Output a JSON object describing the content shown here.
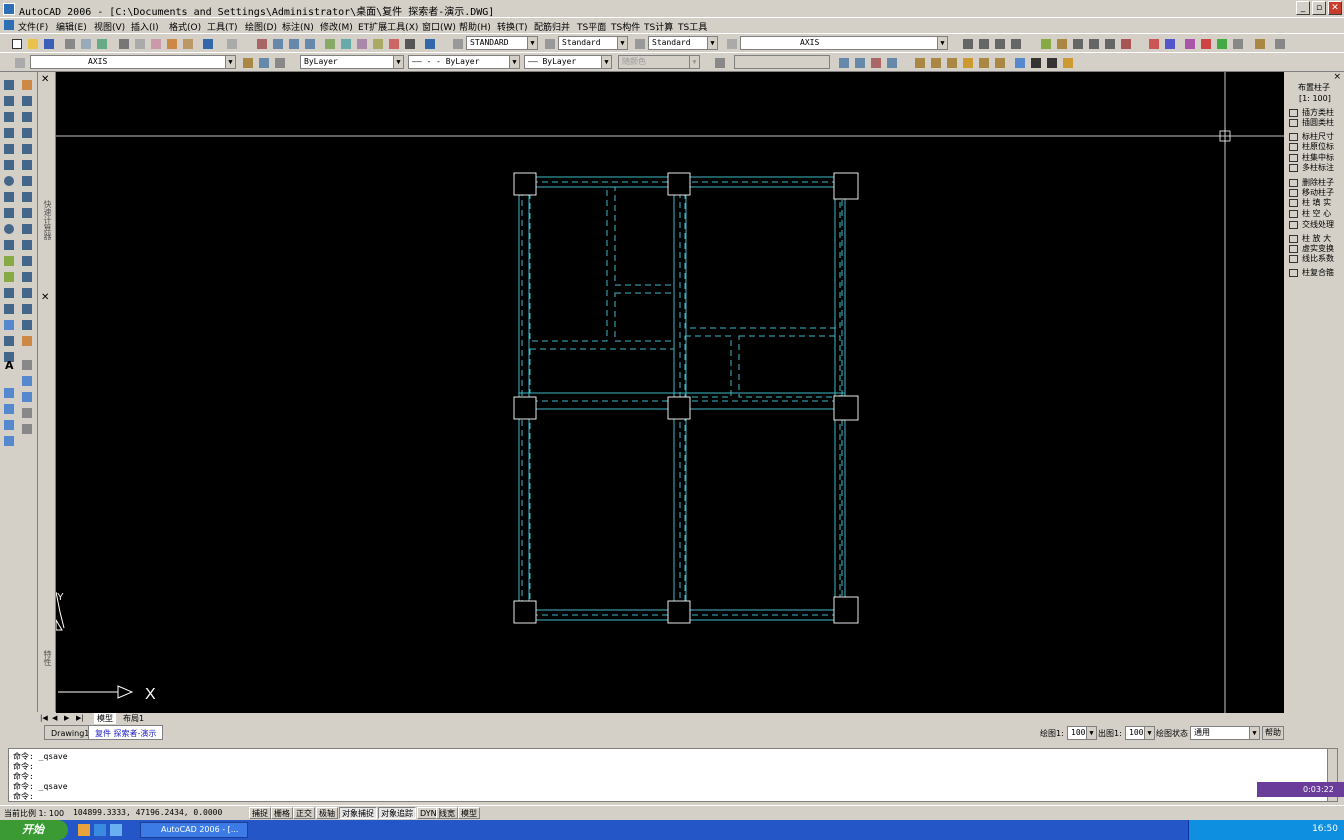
{
  "window": {
    "title": "AutoCAD 2006 - [C:\\Documents and Settings\\Administrator\\桌面\\复件 探索者-演示.DWG]",
    "controls": [
      "_",
      "▫",
      "✕"
    ]
  },
  "menu": [
    "文件(F)",
    "编辑(E)",
    "视图(V)",
    "插入(I)",
    "格式(O)",
    "工具(T)",
    "绘图(D)",
    "标注(N)",
    "修改(M)",
    "ET扩展工具(X)",
    "窗口(W)",
    "帮助(H)",
    "转换(T)",
    "配筋归并",
    "TS平面",
    "TS构件",
    "TS计算",
    "TS工具"
  ],
  "toolbar": {
    "text_style": "STANDARD",
    "dim_style": "Standard",
    "table_style": "Standard",
    "layer_top": "AXIS",
    "layer": "AXIS",
    "color": "ByLayer",
    "linetype": "—— - - ByLayer",
    "lineweight": "—— ByLayer",
    "plotstyle": "随颜色"
  },
  "canvas": {
    "crosshair_icon": "pickbox-cursor"
  },
  "ucs": {
    "x_label": "X",
    "y_label": "Y"
  },
  "palette": {
    "label_top": "快速计算器",
    "label_bottom": "特性"
  },
  "right_panel": {
    "title": "布置柱子",
    "scale": "[1: 100]",
    "items": [
      "插方类柱",
      "插圆类柱",
      "标柱尺寸",
      "柱原位标",
      "柱集中标",
      "多柱标注",
      "删除柱子",
      "移动柱子",
      "柱 填 实",
      "柱 空 心",
      "交线处理",
      "柱 放 大",
      "虚实变换",
      "线比系数",
      "柱复合箍"
    ]
  },
  "layout_tabs": [
    "模型",
    "布局1"
  ],
  "file_tabs": [
    "Drawing1",
    "复件 探索者-演示"
  ],
  "draw_ctrl": {
    "draw_scale_label": "绘图1:",
    "draw_scale": "100",
    "out_scale_label": "出图1:",
    "out_scale": "100",
    "state_label": "绘图状态",
    "state": "通用",
    "help": "帮助"
  },
  "command_lines": [
    "命令: _qsave",
    "命令:",
    "命令:",
    "命令: _qsave",
    "命令:"
  ],
  "status": {
    "scale": "当前比例 1: 100",
    "coords": "104899.3333, 47196.2434, 0.0000",
    "buttons": [
      {
        "label": "捕捉",
        "on": false
      },
      {
        "label": "栅格",
        "on": false
      },
      {
        "label": "正交",
        "on": false
      },
      {
        "label": "极轴",
        "on": false
      },
      {
        "label": "对象捕捉",
        "on": true
      },
      {
        "label": "对象追踪",
        "on": true
      },
      {
        "label": "DYN",
        "on": false
      },
      {
        "label": "线宽",
        "on": false
      },
      {
        "label": "模型",
        "on": false
      }
    ]
  },
  "recorder": {
    "time": "0:03:22"
  },
  "taskbar": {
    "start": "开始",
    "app": "AutoCAD 2006 - [...",
    "clock": "16:50"
  }
}
